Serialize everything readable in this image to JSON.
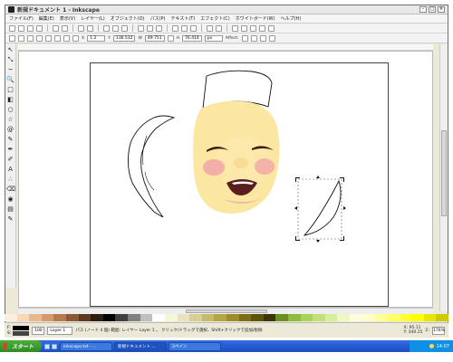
{
  "window": {
    "title": "新規ドキュメント 1 - Inkscape"
  },
  "menu": [
    "ファイル(F)",
    "編集(E)",
    "表示(V)",
    "レイヤー(L)",
    "オブジェクト(O)",
    "パス(P)",
    "テキスト(T)",
    "エフェクト(C)",
    "ホワイトボード(W)",
    "ヘルプ(H)"
  ],
  "controls": {
    "x_label": "X",
    "x_value": "1.2",
    "y_label": "Y",
    "y_value": "136.532",
    "w_label": "W",
    "w_value": "49.751",
    "h_label": "H",
    "h_value": "76.414",
    "unit": "px",
    "affect_label": "Affect:"
  },
  "tools": [
    "select",
    "node",
    "tweak",
    "zoom",
    "rect",
    "3dbox",
    "ellipse",
    "star",
    "spiral",
    "pencil",
    "pen",
    "callig",
    "text",
    "spray",
    "eraser",
    "bucket",
    "gradient",
    "dropper"
  ],
  "tool_glyphs": [
    "↖",
    "⤡",
    "~",
    "🔍",
    "□",
    "◧",
    "○",
    "☆",
    "@",
    "✎",
    "✒",
    "✐",
    "A",
    "∴",
    "⌫",
    "◉",
    "▤",
    "✎"
  ],
  "palette": [
    "#fcefe0",
    "#f7d9b8",
    "#e8b88f",
    "#d49a6b",
    "#b87a4c",
    "#8a5a34",
    "#5c3a20",
    "#2e1e10",
    "#000000",
    "#404040",
    "#808080",
    "#bfbfbf",
    "#ffffff",
    "#f5f5dc",
    "#e8e2c0",
    "#d8cf96",
    "#c6bb6c",
    "#b4a548",
    "#9c8c2c",
    "#7d6e16",
    "#5d5208",
    "#3e3600",
    "#6b8e23",
    "#8fbc3f",
    "#a8d25c",
    "#c2e07a",
    "#d9ee9a",
    "#eef8c0",
    "#fdfde0",
    "#ffffcc",
    "#ffff99",
    "#ffff66",
    "#ffff33",
    "#ffff00",
    "#e6e600",
    "#cccc00"
  ],
  "status": {
    "fill_label": "F:",
    "stroke_label": "S:",
    "opacity": "100",
    "layer": "Layer 1",
    "message": "パス (ノード 4 個) 範囲: レイヤー Layer 1 。 クリック/ドラッグで選択、Shift+クリックで追加/削除",
    "coords_x_label": "X:",
    "coords_x": "95.11",
    "coords_y_label": "Y:",
    "coords_y": "340.15",
    "zoom_label": "Z:",
    "zoom": "176%"
  },
  "taskbar": {
    "start": "スタート",
    "buttons": [
      "inkscape.txt - ...",
      "新規ドキュメント ...",
      "3ペイン"
    ],
    "clock": "14:07"
  },
  "colors": {
    "face": "#fbe7a1",
    "cheek": "#f2a9a7",
    "mouth": "#5b1e1e",
    "brow": "#3b1f14"
  }
}
